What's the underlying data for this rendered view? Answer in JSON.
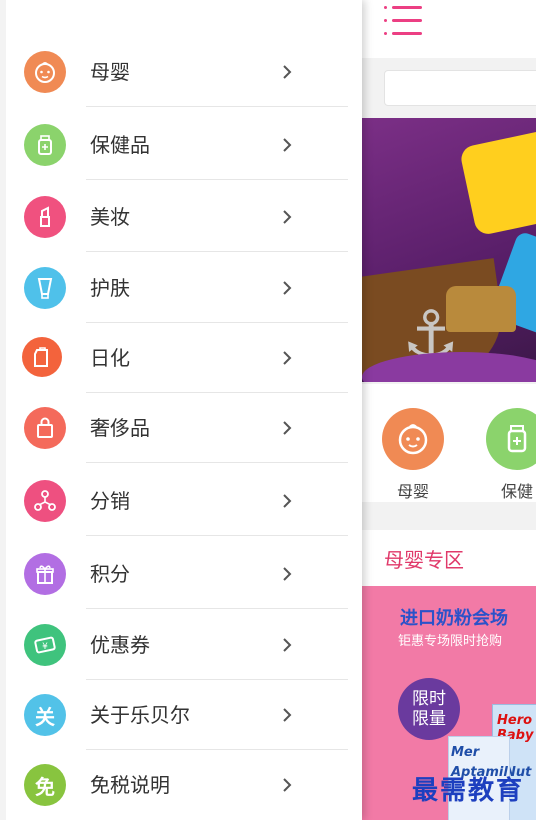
{
  "drawer": {
    "items": [
      {
        "label": "母婴",
        "icon": "baby-face-icon",
        "color": "#f08a54"
      },
      {
        "label": "保健品",
        "icon": "medicine-bottle-icon",
        "color": "#8bd36c"
      },
      {
        "label": "美妆",
        "icon": "lipstick-icon",
        "color": "#f0517f"
      },
      {
        "label": "护肤",
        "icon": "skincare-tube-icon",
        "color": "#4fc1ea"
      },
      {
        "label": "日化",
        "icon": "daily-chemical-icon",
        "color": "#f3633c"
      },
      {
        "label": "奢侈品",
        "icon": "shopping-bag-icon",
        "color": "#f46a5b"
      },
      {
        "label": "分销",
        "icon": "distribution-nodes-icon",
        "color": "#ee5080"
      },
      {
        "label": "积分",
        "icon": "gift-icon",
        "color": "#b26ee3"
      },
      {
        "label": "优惠券",
        "icon": "coupon-icon",
        "color": "#3fc37d"
      },
      {
        "label": "关于乐贝尔",
        "icon_text": "关",
        "icon": "about-icon",
        "color": "#52c2e8"
      },
      {
        "label": "免税说明",
        "icon_text": "免",
        "icon": "tax-free-icon",
        "color": "#88c43f"
      }
    ]
  },
  "main": {
    "accent": "#ec3f83",
    "categories": [
      {
        "label": "母婴",
        "color": "#f08a54"
      },
      {
        "label": "保健",
        "color": "#8bd36c"
      }
    ],
    "zone_title": "母婴专区",
    "promo": {
      "title": "进口奶粉会场",
      "subtitle": "钜惠专场限时抢购",
      "badge_line1": "限时",
      "badge_line2": "限量",
      "product_text_1": "Hero Baby",
      "product_text_2": "Aptamil",
      "product_text_3": "Nut",
      "product_text_4": "Mer"
    }
  },
  "watermark": "最需教育"
}
